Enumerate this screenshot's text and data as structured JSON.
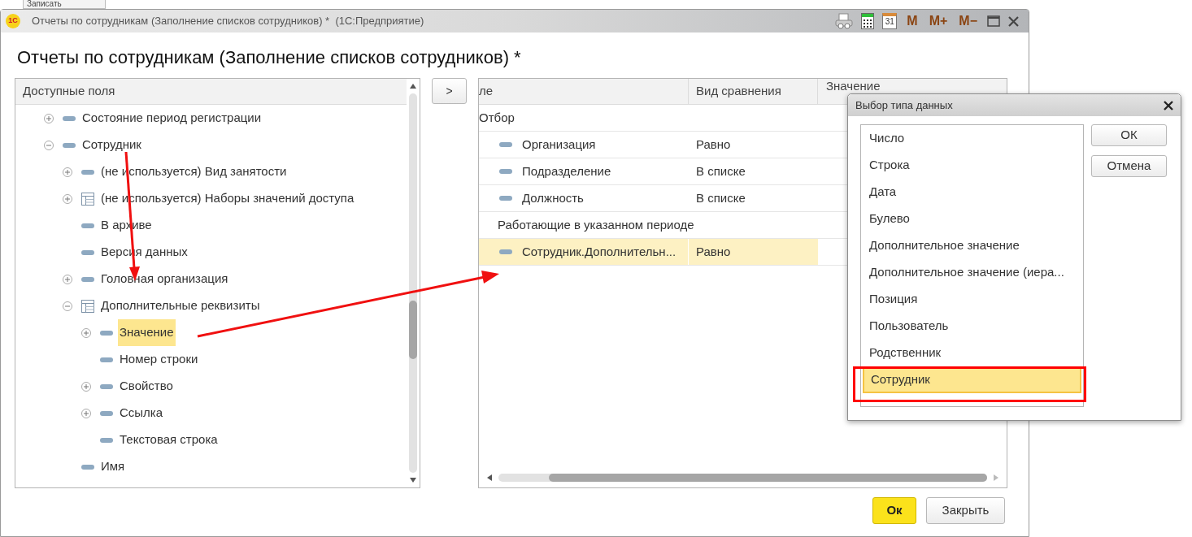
{
  "background_button": {
    "label": "Записать"
  },
  "window": {
    "logo": "1С",
    "title": "Отчеты по сотрудникам (Заполнение списков сотрудников) *  (1С:Предприятие)",
    "tools": [
      {
        "kind": "print"
      },
      {
        "kind": "calculator"
      },
      {
        "kind": "calendar",
        "label": "31"
      },
      {
        "kind": "text",
        "label": "M"
      },
      {
        "kind": "text",
        "label": "M+"
      },
      {
        "kind": "text",
        "label": "M−"
      },
      {
        "kind": "maximize"
      },
      {
        "kind": "close"
      }
    ]
  },
  "heading": "Отчеты по сотрудникам (Заполнение списков сотрудников) *",
  "fields_tree": {
    "header": "Доступные поля",
    "items": [
      {
        "label": "Состояние период регистрации",
        "kind": "field",
        "expanded": false,
        "selected": false
      },
      {
        "label": "Сотрудник",
        "kind": "field",
        "expanded": true,
        "selected": false,
        "children": [
          {
            "label": "(не используется) Вид занятости",
            "kind": "field",
            "expanded": false,
            "selected": false
          },
          {
            "label": "(не используется) Наборы значений доступа",
            "kind": "table",
            "expanded": false,
            "selected": false
          },
          {
            "label": "В архиве",
            "kind": "field",
            "selected": false
          },
          {
            "label": "Версия данных",
            "kind": "field",
            "selected": false
          },
          {
            "label": "Головная организация",
            "kind": "field",
            "expanded": false,
            "selected": false
          },
          {
            "label": "Дополнительные реквизиты",
            "kind": "table",
            "expanded": true,
            "selected": false,
            "children": [
              {
                "label": "Значение",
                "kind": "field",
                "expanded": false,
                "selected": true
              },
              {
                "label": "Номер строки",
                "kind": "field",
                "selected": false
              },
              {
                "label": "Свойство",
                "kind": "field",
                "expanded": false,
                "selected": false
              },
              {
                "label": "Ссылка",
                "kind": "field",
                "expanded": false,
                "selected": false
              },
              {
                "label": "Текстовая строка",
                "kind": "field",
                "selected": false
              }
            ]
          },
          {
            "label": "Имя",
            "kind": "field",
            "selected": false
          }
        ]
      }
    ]
  },
  "add_button": ">",
  "filter_table": {
    "columns": [
      "ле",
      "Вид сравнения",
      "Значение"
    ],
    "rows": [
      {
        "kind": "root",
        "label": "Отбор",
        "selected": false
      },
      {
        "kind": "filter",
        "label": "Организация",
        "comparison": "Равно",
        "selected": false
      },
      {
        "kind": "filter",
        "label": "Подразделение",
        "comparison": "В списке",
        "selected": false
      },
      {
        "kind": "filter",
        "label": "Должность",
        "comparison": "В списке",
        "selected": false
      },
      {
        "kind": "group",
        "label": "Работающие в указанном периоде",
        "selected": false
      },
      {
        "kind": "filter",
        "label": "Сотрудник.Дополнительн...",
        "comparison": "Равно",
        "selected": true
      }
    ]
  },
  "buttons": [
    {
      "label": "Ок",
      "default": true
    },
    {
      "label": "Закрыть",
      "default": false
    }
  ],
  "type_dialog": {
    "title": "Выбор типа данных",
    "types": [
      {
        "label": "Число",
        "selected": false
      },
      {
        "label": "Строка",
        "selected": false
      },
      {
        "label": "Дата",
        "selected": false
      },
      {
        "label": "Булево",
        "selected": false
      },
      {
        "label": "Дополнительное значение",
        "selected": false
      },
      {
        "label": "Дополнительное значение (иера...",
        "selected": false
      },
      {
        "label": "Позиция",
        "selected": false
      },
      {
        "label": "Пользователь",
        "selected": false
      },
      {
        "label": "Родственник",
        "selected": false
      },
      {
        "label": "Сотрудник",
        "selected": true
      }
    ],
    "buttons": [
      "ОК",
      "Отмена"
    ]
  }
}
